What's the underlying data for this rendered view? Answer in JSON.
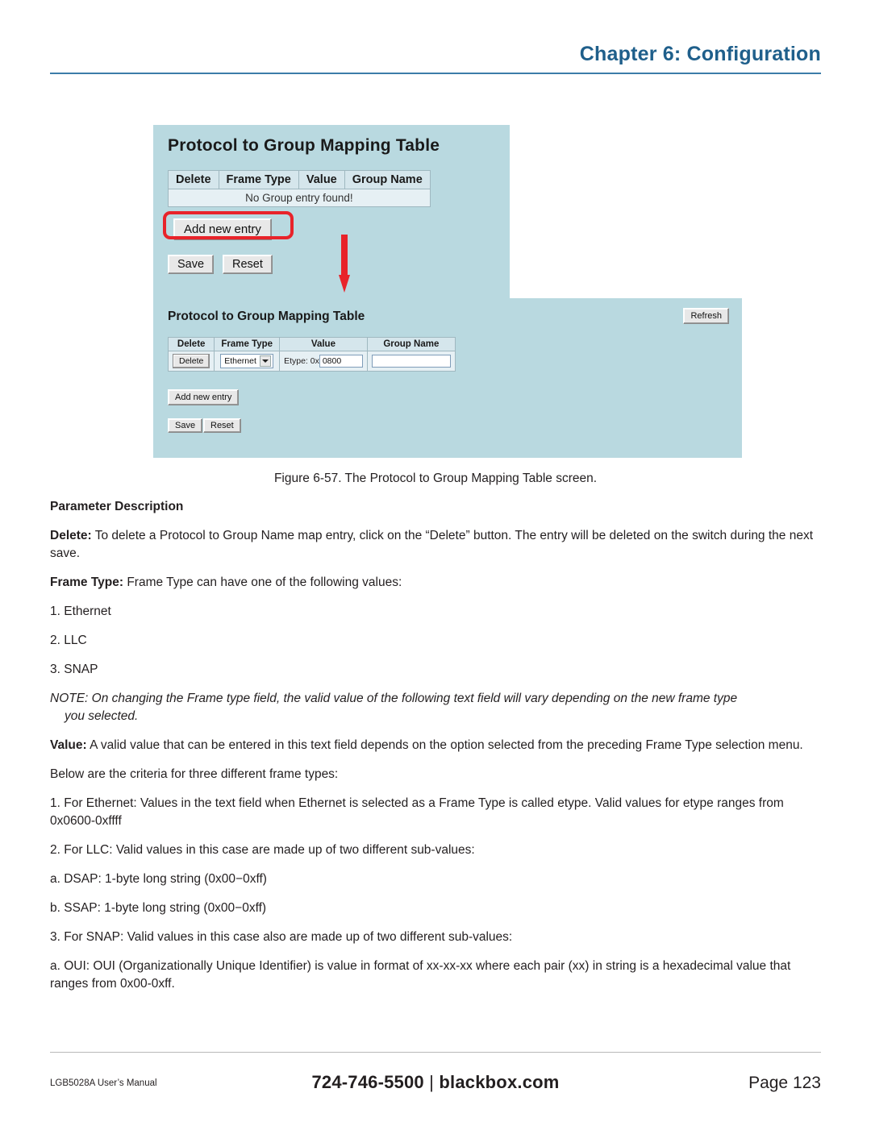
{
  "header": {
    "chapter_title": "Chapter 6: Configuration"
  },
  "figure": {
    "caption": "Figure 6-57. The Protocol to Group Mapping Table screen.",
    "top_panel": {
      "title": "Protocol to Group Mapping Table",
      "columns": [
        "Delete",
        "Frame Type",
        "Value",
        "Group Name"
      ],
      "empty_row": "No Group entry found!",
      "add_new_entry": "Add new entry",
      "save": "Save",
      "reset": "Reset"
    },
    "bottom_panel": {
      "title": "Protocol to Group Mapping Table",
      "refresh": "Refresh",
      "columns": [
        "Delete",
        "Frame Type",
        "Value",
        "Group Name"
      ],
      "row": {
        "delete": "Delete",
        "frame_type": "Ethernet",
        "value_label": "Etype: 0x",
        "value": "0800",
        "group_name": ""
      },
      "add_new_entry": "Add new entry",
      "save": "Save",
      "reset": "Reset"
    }
  },
  "body": {
    "section_heading": "Parameter Description",
    "delete_label": "Delete:",
    "delete_text": " To delete a Protocol to Group Name map entry, click on the “Delete” button. The entry will be deleted on the switch during the next save.",
    "frame_type_label": "Frame Type:",
    "frame_type_text": " Frame Type can have one of the following values:",
    "frame_type_list": [
      "1. Ethernet",
      "2. LLC",
      "3. SNAP"
    ],
    "note_line1": "NOTE: On changing the Frame type field, the valid value of the following text field will vary depending on the new frame type",
    "note_line2": "you selected.",
    "value_label": "Value:",
    "value_text": " A valid value that can be entered in this text field depends on the option selected from the preceding Frame Type selection menu.",
    "criteria_intro": "Below are the criteria for three different frame types:",
    "item1": "1. For Ethernet: Values in the text field when Ethernet is selected as a Frame Type is called etype. Valid values for etype ranges from 0x0600-0xffff",
    "item2": "2. For LLC: Valid values in this case are made up of two different sub-values:",
    "item2a": "a. DSAP: 1-byte long string (0x00−0xff)",
    "item2b": "b. SSAP: 1-byte long string (0x00−0xff)",
    "item3": "3. For SNAP: Valid values in this case also are made up of two different sub-values:",
    "item3a": "a. OUI: OUI (Organizationally Unique Identifier) is value in format of xx-xx-xx where each pair (xx) in string is a hexadecimal value that ranges from 0x00-0xff."
  },
  "footer": {
    "manual": "LGB5028A User’s Manual",
    "phone": "724-746-5500",
    "separator": "|",
    "site": "blackbox.com",
    "page_label": "Page",
    "page_number": "123"
  }
}
